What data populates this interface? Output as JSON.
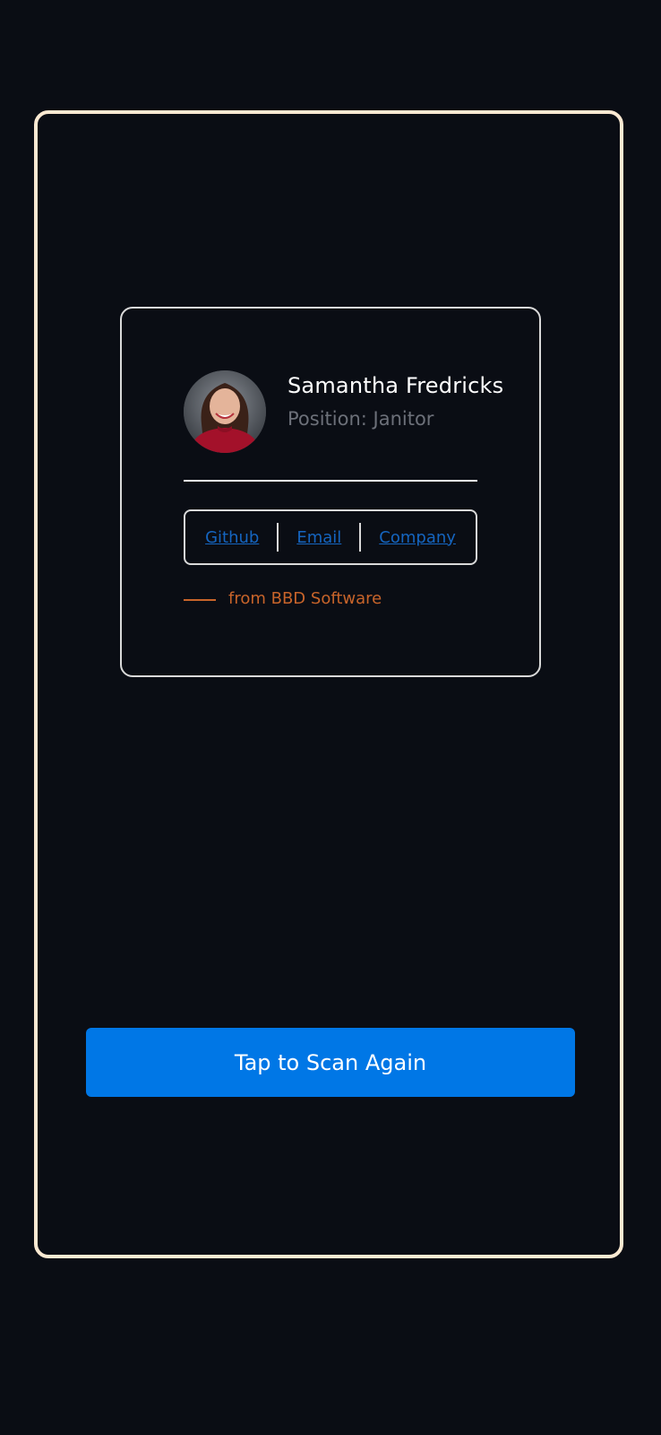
{
  "profile": {
    "name": "Samantha Fredricks",
    "position": "Position: Janitor",
    "avatar_icon": "person-photo"
  },
  "links": {
    "github": "Github",
    "email": "Email",
    "company": "Company",
    "link_color": "#1565c0"
  },
  "footer": {
    "from_text": "from BBD Software",
    "accent_color": "#c8642a"
  },
  "action": {
    "scan_again_label": "Tap to Scan Again",
    "button_color": "#0077e6"
  },
  "theme": {
    "background": "#0a0d14",
    "frame_border": "#fbe9d2"
  }
}
